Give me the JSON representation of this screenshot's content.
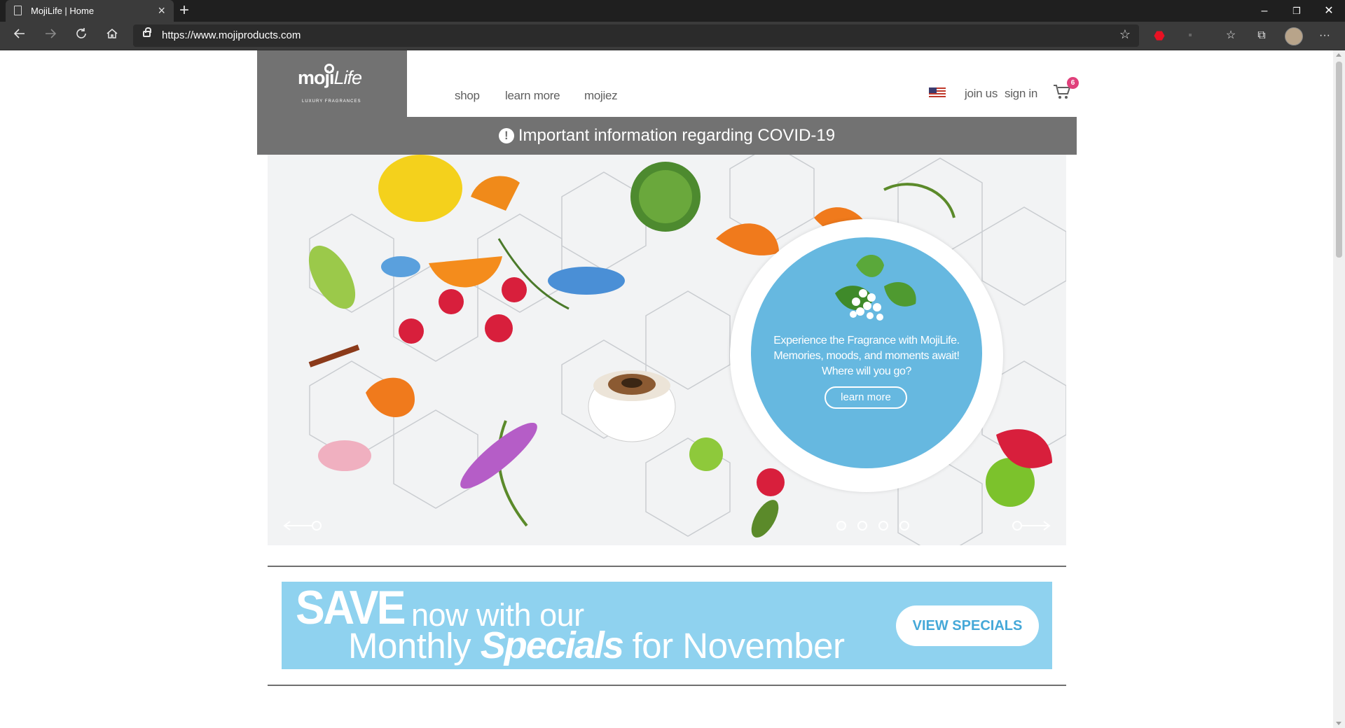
{
  "browser": {
    "tab_title": "MojiLife | Home",
    "tab_close": "×",
    "new_tab": "+",
    "url": "https://www.mojiproducts.com",
    "window_controls": {
      "minimize": "–",
      "restore": "❐",
      "close": "✕"
    },
    "icons": {
      "back": "back-icon",
      "forward": "forward-icon",
      "refresh": "refresh-icon",
      "home": "home-icon",
      "lock": "lock-icon",
      "favorite": "star-icon",
      "extension": "stop-icon",
      "favorites_list": "favorites-icon",
      "collections": "collections-icon",
      "profile": "avatar",
      "more": "more-icon"
    }
  },
  "site": {
    "logo": {
      "word_bold": "moji",
      "word_light": "Life",
      "tagline": "LUXURY FRAGRANCES"
    },
    "nav": {
      "shop": "shop",
      "learn_more": "learn more",
      "mojiez": "mojiez"
    },
    "user_nav": {
      "join_us": "join us",
      "sign_in": "sign in",
      "cart_count": "6"
    },
    "covid": {
      "icon": "!",
      "text": "Important information regarding COVID-19"
    },
    "hero": {
      "text": "Experience the Fragrance with MojiLife. Memories, moods, and moments await! Where will you go?",
      "button": "learn more",
      "slide_count": 4,
      "active_slide": 1
    },
    "promo": {
      "save": "SAVE",
      "line1": "now with our",
      "line2_a": "Monthly",
      "line2_b": "Specials",
      "line2_c": "for November",
      "button": "VIEW SPECIALS"
    }
  }
}
